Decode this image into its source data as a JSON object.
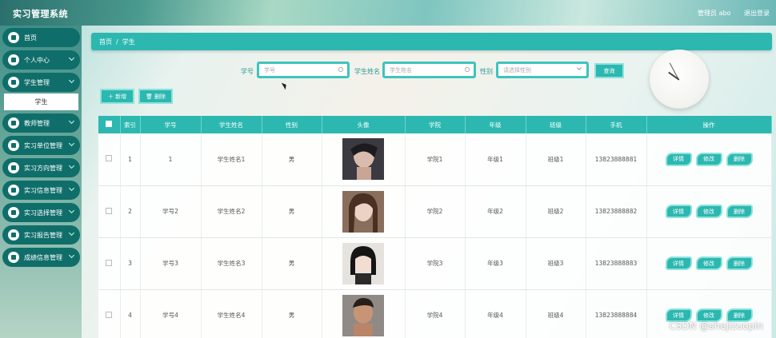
{
  "app": {
    "title": "实习管理系统"
  },
  "header": {
    "user_label": "管理员 abo",
    "logout_label": "退出登录"
  },
  "sidebar": {
    "items": [
      {
        "label": "首页"
      },
      {
        "label": "个人中心"
      },
      {
        "label": "学生管理"
      },
      {
        "label": "教师管理"
      },
      {
        "label": "实习单位管理"
      },
      {
        "label": "实习方向管理"
      },
      {
        "label": "实习信息管理"
      },
      {
        "label": "实习选择管理"
      },
      {
        "label": "实习报告管理"
      },
      {
        "label": "成绩信息管理"
      }
    ],
    "active_sub": "学生"
  },
  "breadcrumb": {
    "home": "首页",
    "separator": "/",
    "current": "学生"
  },
  "search": {
    "id_label": "学号",
    "id_placeholder": "学号",
    "name_label": "学生姓名",
    "name_placeholder": "学生姓名",
    "gender_label": "性别",
    "gender_placeholder": "请选择性别",
    "query_label": "查询"
  },
  "actions": {
    "add_label": "＋ 新增",
    "delete_label": "🗑 删除"
  },
  "table": {
    "headers": [
      "索引",
      "学号",
      "学生姓名",
      "性别",
      "头像",
      "学院",
      "年级",
      "班级",
      "手机",
      "操作"
    ],
    "rows": [
      {
        "index": "1",
        "id": "1",
        "name": "学生姓名1",
        "gender": "男",
        "college": "学院1",
        "grade": "年级1",
        "class": "班级1",
        "phone": "13823888881"
      },
      {
        "index": "2",
        "id": "学号2",
        "name": "学生姓名2",
        "gender": "男",
        "college": "学院2",
        "grade": "年级2",
        "class": "班级2",
        "phone": "13823888882"
      },
      {
        "index": "3",
        "id": "学号3",
        "name": "学生姓名3",
        "gender": "男",
        "college": "学院3",
        "grade": "年级3",
        "class": "班级3",
        "phone": "13823888883"
      },
      {
        "index": "4",
        "id": "学号4",
        "name": "学生姓名4",
        "gender": "男",
        "college": "学院4",
        "grade": "年级4",
        "class": "班级4",
        "phone": "13823888884"
      }
    ],
    "op_labels": {
      "detail": "详情",
      "edit": "修改",
      "delete": "删除"
    }
  },
  "watermark": "CSDN @shejizuopin",
  "colors": {
    "accent": "#2cb8b0",
    "sidebar_item": "#0f6e6a",
    "accent_border": "#8de3dd"
  }
}
